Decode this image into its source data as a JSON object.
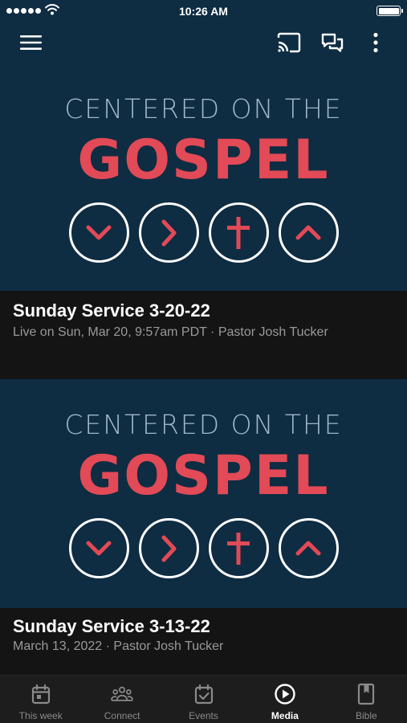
{
  "status_bar": {
    "time": "10:26 AM",
    "signal_icon": "signal-dots-icon",
    "wifi_icon": "wifi-icon",
    "battery_icon": "battery-icon"
  },
  "header": {
    "menu_icon": "hamburger-menu-icon",
    "cast_icon": "cast-icon",
    "chat_icon": "chat-icon",
    "more_icon": "more-vertical-icon"
  },
  "media": [
    {
      "art_line1": "CENTERED ON THE",
      "art_line2": "GOSPEL",
      "title": "Sunday Service 3-20-22",
      "subtitle": "Live on Sun, Mar 20, 9:57am PDT · Pastor Josh Tucker"
    },
    {
      "art_line1": "CENTERED ON THE",
      "art_line2": "GOSPEL",
      "title": "Sunday Service 3-13-22",
      "subtitle": "March 13, 2022 · Pastor Josh Tucker"
    }
  ],
  "tabs": [
    {
      "label": "This week",
      "icon": "calendar-icon",
      "active": false
    },
    {
      "label": "Connect",
      "icon": "people-icon",
      "active": false
    },
    {
      "label": "Events",
      "icon": "calendar-check-icon",
      "active": false
    },
    {
      "label": "Media",
      "icon": "play-circle-icon",
      "active": true
    },
    {
      "label": "Bible",
      "icon": "book-icon",
      "active": false
    }
  ],
  "colors": {
    "header_bg": "#0e2c42",
    "accent_red": "#e14a56",
    "background": "#141414",
    "tab_active": "#ffffff",
    "tab_inactive": "#8a8a8a"
  }
}
